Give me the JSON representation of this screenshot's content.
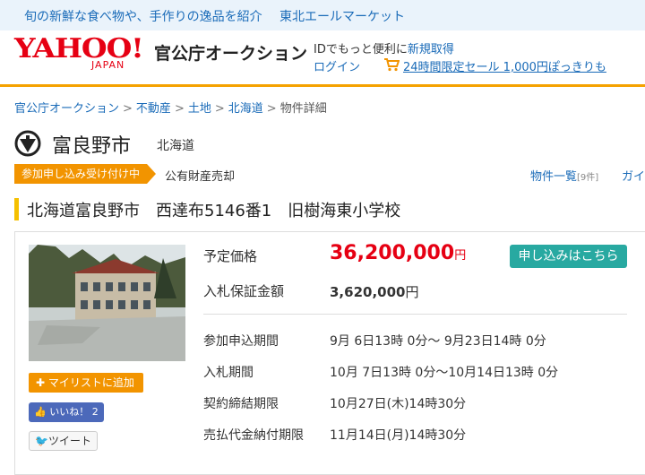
{
  "promo": {
    "text": "旬の新鮮な食べ物や、手作りの逸品を紹介",
    "market": "東北エールマーケット"
  },
  "header": {
    "logo_main": "YAHOO!",
    "logo_sub": "JAPAN",
    "site_title": "官公庁オークション",
    "id_text": "IDでもっと便利に",
    "register": "新規取得",
    "login": "ログイン",
    "sale": "24時間限定セール 1,000円ぽっきりも"
  },
  "breadcrumb": {
    "items": [
      "官公庁オークション",
      "不動産",
      "土地",
      "北海道"
    ],
    "current": "物件詳細",
    "sep": ">"
  },
  "org": {
    "city": "富良野市",
    "pref": "北海道"
  },
  "status": {
    "badge": "参加申し込み受け付け中",
    "kind": "公有財産売却"
  },
  "nav": {
    "list": "物件一覧",
    "list_count": "[9件]",
    "guide": "ガイ"
  },
  "property": {
    "title": "北海道富良野市　西達布5146番1　旧樹海東小学校",
    "price_label": "予定価格",
    "price": "36,200,000",
    "price_unit": "円",
    "deposit_label": "入札保証金額",
    "deposit": "3,620,000",
    "deposit_unit": "円",
    "apply": "申し込みはこちら",
    "schedule": [
      {
        "label": "参加申込期間",
        "value": " 9月 6日13時 0分～ 9月23日14時 0分"
      },
      {
        "label": "入札期間",
        "value": "10月 7日13時 0分～10月14日13時 0分"
      },
      {
        "label": "契約締結期限",
        "value": "10月27日(木)14時30分"
      },
      {
        "label": "売払代金納付期限",
        "value": "11月14日(月)14時30分"
      }
    ]
  },
  "actions": {
    "mylist": "マイリストに追加",
    "like": "いいね！ 2",
    "tweet": "ツイート"
  },
  "colors": {
    "accent": "#f29400",
    "price": "#e60013",
    "apply": "#28a9a1",
    "link": "#1a6bb8"
  }
}
